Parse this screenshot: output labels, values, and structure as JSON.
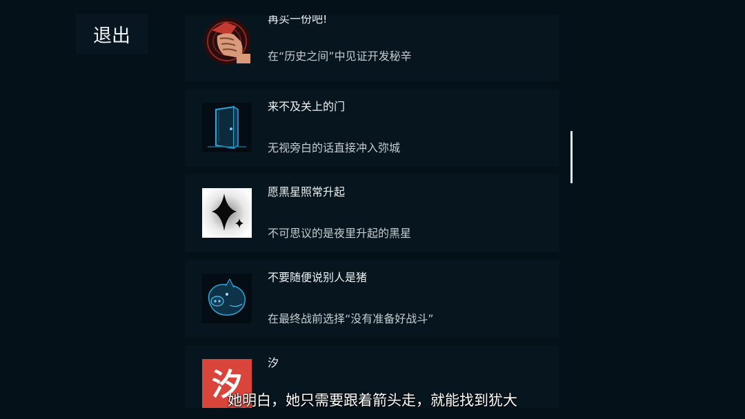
{
  "header": {
    "exit_label": "退出"
  },
  "achievements": [
    {
      "title": "再买一份吧!",
      "description": "在“历史之间”中见证开发秘辛",
      "icon": "fist-icon"
    },
    {
      "title": "来不及关上的门",
      "description": "无视旁白的话直接冲入弥城",
      "icon": "door-icon"
    },
    {
      "title": "愿黑星照常升起",
      "description": "不可思议的是夜里升起的黑星",
      "icon": "black-star-icon"
    },
    {
      "title": "不要随便说别人是猪",
      "description": "在最终战前选择“没有准备好战斗”",
      "icon": "pig-icon"
    },
    {
      "title": "汐",
      "description": "",
      "icon": "xi-character-icon",
      "icon_text": "汐"
    }
  ],
  "subtitle_text": "她明白，她只需要跟着箭头走，就能找到犹大",
  "colors": {
    "background": "#051119",
    "card": "#07151e",
    "accent_red": "#d9453a",
    "accent_blue": "#2fa6d8"
  }
}
